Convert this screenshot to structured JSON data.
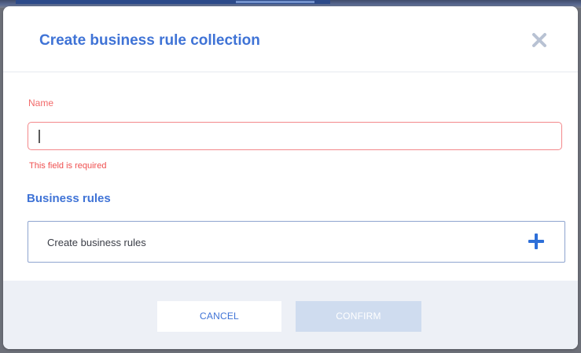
{
  "dialog": {
    "title": "Create business rule collection",
    "close_icon": "close-icon"
  },
  "form": {
    "name_label": "Name",
    "name_value": "",
    "name_error": "This field is required"
  },
  "business_rules": {
    "section_title": "Business rules",
    "create_label": "Create business rules",
    "add_icon": "plus-icon"
  },
  "footer": {
    "cancel_label": "CANCEL",
    "confirm_label": "CONFIRM",
    "confirm_enabled": false
  },
  "colors": {
    "accent": "#3f73d6",
    "error": "#ef4f4f",
    "error_border": "#f3888b",
    "disabled_button": "#cfdcef",
    "footer_bg": "#edf0f6"
  }
}
